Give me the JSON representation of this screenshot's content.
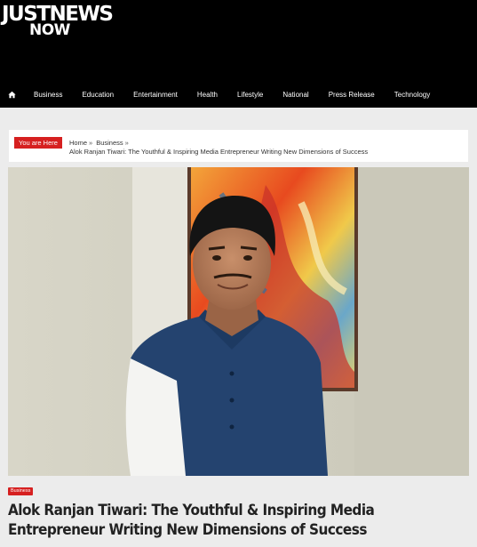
{
  "site": {
    "logo_top": "JUSTNEWS",
    "logo_bottom": "NOW"
  },
  "nav": {
    "home_icon": "home-icon",
    "items": [
      {
        "label": "Business"
      },
      {
        "label": "Education"
      },
      {
        "label": "Entertainment"
      },
      {
        "label": "Health"
      },
      {
        "label": "Lifestyle"
      },
      {
        "label": "National"
      },
      {
        "label": "Press Release"
      },
      {
        "label": "Technology"
      }
    ]
  },
  "breadcrumb": {
    "label": "You are Here",
    "items": [
      "Home",
      "Business"
    ],
    "separator": "»",
    "current": "Alok Ranjan Tiwari: The Youthful & Inspiring Media Entrepreneur Writing New Dimensions of Success"
  },
  "article": {
    "category": "Business",
    "title": "Alok Ranjan Tiwari: The Youthful & Inspiring Media Entrepreneur Writing New Dimensions of Success"
  },
  "colors": {
    "header_bg": "#000000",
    "accent": "#d62020",
    "page_bg": "#ececec"
  }
}
